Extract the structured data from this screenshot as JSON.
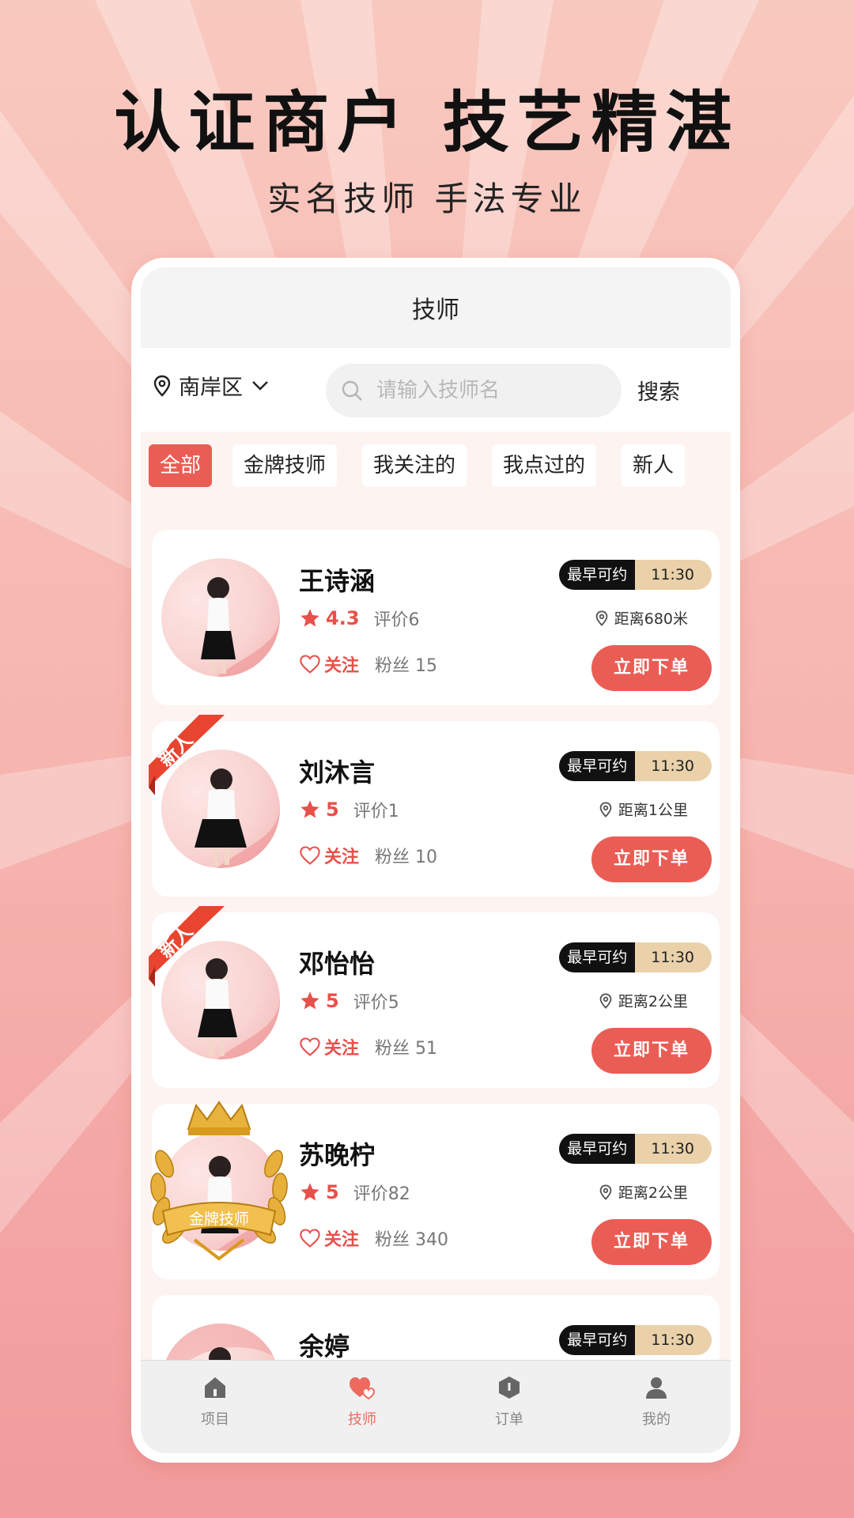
{
  "hero": {
    "headline": "认证商户 技艺精湛",
    "subline": "实名技师 手法专业"
  },
  "nav": {
    "title": "技师"
  },
  "location": {
    "label": "南岸区",
    "icon": "location-pin-icon",
    "dropdown_icon": "chevron-down-icon"
  },
  "search": {
    "placeholder": "请输入技师名",
    "value": "",
    "button_label": "搜索"
  },
  "filters": [
    {
      "label": "全部",
      "active": true
    },
    {
      "label": "金牌技师",
      "active": false
    },
    {
      "label": "我关注的",
      "active": false
    },
    {
      "label": "我点过的",
      "active": false
    },
    {
      "label": "新人",
      "active": false
    }
  ],
  "slot_label": "最早可约",
  "follow_label": "关注",
  "fans_prefix": "粉丝",
  "reviews_prefix": "评价",
  "order_label": "立即下单",
  "new_badge_label": "新人",
  "gold_badge_label": "金牌技师",
  "technicians": [
    {
      "name": "王诗涵",
      "score": "4.3",
      "reviews": "评价6",
      "fans": "粉丝 15",
      "time": "11:30",
      "distance": "距离680米",
      "badge": ""
    },
    {
      "name": "刘沐言",
      "score": "5",
      "reviews": "评价1",
      "fans": "粉丝 10",
      "time": "11:30",
      "distance": "距离1公里",
      "badge": "new"
    },
    {
      "name": "邓怡怡",
      "score": "5",
      "reviews": "评价5",
      "fans": "粉丝 51",
      "time": "11:30",
      "distance": "距离2公里",
      "badge": "new"
    },
    {
      "name": "苏晚柠",
      "score": "5",
      "reviews": "评价82",
      "fans": "粉丝 340",
      "time": "11:30",
      "distance": "距离2公里",
      "badge": "gold"
    },
    {
      "name": "余婷",
      "score": "",
      "reviews": "",
      "fans": "",
      "time": "11:30",
      "distance": "",
      "badge": ""
    }
  ],
  "tabbar": [
    {
      "label": "项目",
      "icon": "home-icon",
      "active": false
    },
    {
      "label": "技师",
      "icon": "heart-icon",
      "active": true
    },
    {
      "label": "订单",
      "icon": "order-icon",
      "active": false
    },
    {
      "label": "我的",
      "icon": "user-icon",
      "active": false
    }
  ],
  "colors": {
    "accent": "#ea5d55",
    "slot_time_bg": "#ead1aa",
    "slot_label_bg": "#111111"
  }
}
